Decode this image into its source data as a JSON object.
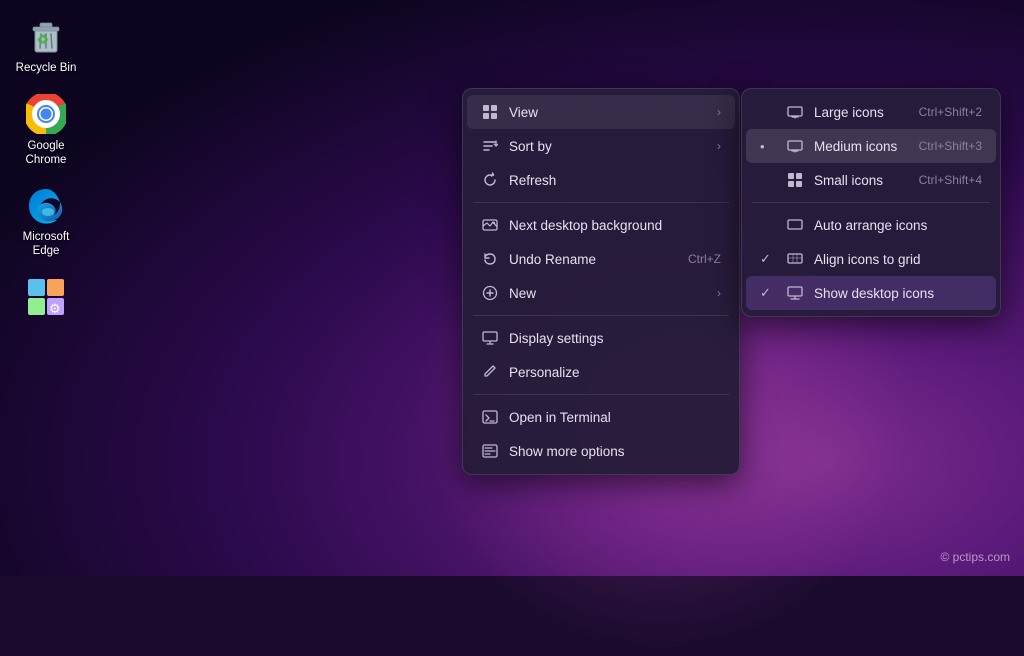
{
  "desktop": {
    "icons": [
      {
        "id": "recycle-bin",
        "label": "Recycle Bin",
        "type": "recycle"
      },
      {
        "id": "google-chrome",
        "label": "Google Chrome",
        "type": "chrome"
      },
      {
        "id": "microsoft-edge",
        "label": "Microsoft Edge",
        "type": "edge"
      },
      {
        "id": "control-panel",
        "label": "",
        "type": "settings"
      }
    ]
  },
  "context_menu": {
    "items": [
      {
        "id": "view",
        "icon": "grid",
        "label": "View",
        "arrow": true
      },
      {
        "id": "sort-by",
        "icon": "sort",
        "label": "Sort by",
        "arrow": true
      },
      {
        "id": "refresh",
        "icon": "refresh",
        "label": "Refresh"
      },
      {
        "separator": true
      },
      {
        "id": "next-bg",
        "icon": "image",
        "label": "Next desktop background"
      },
      {
        "id": "undo-rename",
        "icon": "undo",
        "label": "Undo Rename",
        "shortcut": "Ctrl+Z"
      },
      {
        "id": "new",
        "icon": "new",
        "label": "New",
        "arrow": true
      },
      {
        "separator": true
      },
      {
        "id": "display-settings",
        "icon": "display",
        "label": "Display settings"
      },
      {
        "id": "personalize",
        "icon": "personalize",
        "label": "Personalize"
      },
      {
        "separator": true
      },
      {
        "id": "open-terminal",
        "icon": "terminal",
        "label": "Open in Terminal"
      },
      {
        "id": "show-more",
        "icon": "more",
        "label": "Show more options"
      }
    ]
  },
  "submenu": {
    "items": [
      {
        "id": "large-icons",
        "check": "",
        "icon": "monitor",
        "label": "Large icons",
        "shortcut": "Ctrl+Shift+2"
      },
      {
        "id": "medium-icons",
        "check": "•",
        "icon": "monitor",
        "label": "Medium icons",
        "shortcut": "Ctrl+Shift+3",
        "active": true
      },
      {
        "id": "small-icons",
        "check": "",
        "icon": "grid-small",
        "label": "Small icons",
        "shortcut": "Ctrl+Shift+4"
      },
      {
        "separator": true
      },
      {
        "id": "auto-arrange",
        "check": "",
        "icon": "auto-arrange",
        "label": "Auto arrange icons"
      },
      {
        "id": "align-grid",
        "check": "✓",
        "icon": "align-grid",
        "label": "Align icons to grid"
      },
      {
        "id": "show-desktop",
        "check": "✓",
        "icon": "desktop",
        "label": "Show desktop icons",
        "active": true
      }
    ]
  },
  "watermark": "© pctips.com"
}
